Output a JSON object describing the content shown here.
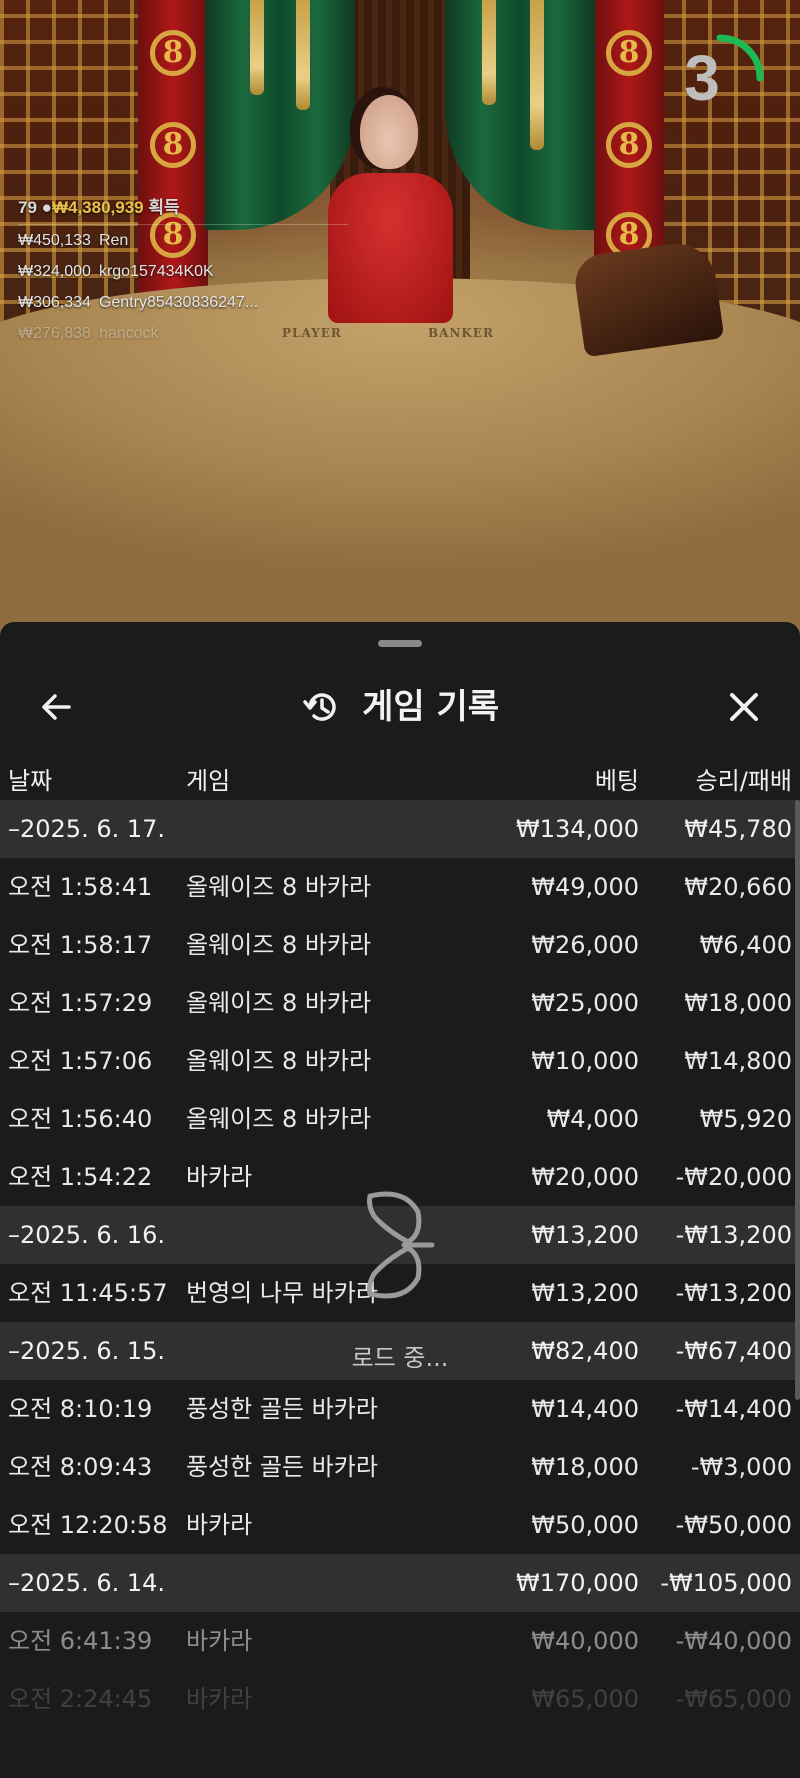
{
  "stream": {
    "countdown": "3",
    "table_labels": {
      "player": "PLAYER",
      "banker": "BANKER"
    },
    "winners_summary": {
      "count": "79",
      "amount": "₩4,380,939",
      "suffix": "획득"
    },
    "winners": [
      {
        "amount": "₩450,133",
        "name": "Ren"
      },
      {
        "amount": "₩324,000",
        "name": "krgo157434K0K"
      },
      {
        "amount": "₩306,334",
        "name": "Gentry85430836247..."
      },
      {
        "amount": "₩276,838",
        "name": "hancock"
      }
    ],
    "colors": {
      "timer_arc": "#1db954",
      "gold": "#e8c24a"
    }
  },
  "history": {
    "title": "게임 기록",
    "icons": {
      "back": "arrow-left-icon",
      "history": "history-icon",
      "close": "close-icon"
    },
    "columns": {
      "date": "날짜",
      "game": "게임",
      "bet": "베팅",
      "win_loss": "승리/패배"
    },
    "groups": [
      {
        "date": "–2025. 6. 17.",
        "bet": "₩134,000",
        "win_loss": "₩45,780",
        "rows": [
          {
            "time": "오전 1:58:41",
            "game": "올웨이즈 8 바카라",
            "bet": "₩49,000",
            "win_loss": "₩20,660"
          },
          {
            "time": "오전 1:58:17",
            "game": "올웨이즈 8 바카라",
            "bet": "₩26,000",
            "win_loss": "₩6,400"
          },
          {
            "time": "오전 1:57:29",
            "game": "올웨이즈 8 바카라",
            "bet": "₩25,000",
            "win_loss": "₩18,000"
          },
          {
            "time": "오전 1:57:06",
            "game": "올웨이즈 8 바카라",
            "bet": "₩10,000",
            "win_loss": "₩14,800"
          },
          {
            "time": "오전 1:56:40",
            "game": "올웨이즈 8 바카라",
            "bet": "₩4,000",
            "win_loss": "₩5,920"
          },
          {
            "time": "오전 1:54:22",
            "game": "바카라",
            "bet": "₩20,000",
            "win_loss": "-₩20,000"
          }
        ]
      },
      {
        "date": "–2025. 6. 16.",
        "bet": "₩13,200",
        "win_loss": "-₩13,200",
        "rows": [
          {
            "time": "오전 11:45:57",
            "game": "번영의 나무 바카라",
            "bet": "₩13,200",
            "win_loss": "-₩13,200"
          }
        ]
      },
      {
        "date": "–2025. 6. 15.",
        "bet": "₩82,400",
        "win_loss": "-₩67,400",
        "rows": [
          {
            "time": "오전 8:10:19",
            "game": "풍성한 골든 바카라",
            "bet": "₩14,400",
            "win_loss": "-₩14,400"
          },
          {
            "time": "오전 8:09:43",
            "game": "풍성한 골든 바카라",
            "bet": "₩18,000",
            "win_loss": "-₩3,000"
          },
          {
            "time": "오전 12:20:58",
            "game": "바카라",
            "bet": "₩50,000",
            "win_loss": "-₩50,000"
          }
        ]
      },
      {
        "date": "–2025. 6. 14.",
        "bet": "₩170,000",
        "win_loss": "-₩105,000",
        "rows": [
          {
            "time": "오전 6:41:39",
            "game": "바카라",
            "bet": "₩40,000",
            "win_loss": "-₩40,000"
          },
          {
            "time": "오전 2:24:45",
            "game": "바카라",
            "bet": "₩65,000",
            "win_loss": "-₩65,000"
          }
        ]
      }
    ],
    "loading_text": "로드 중..."
  }
}
